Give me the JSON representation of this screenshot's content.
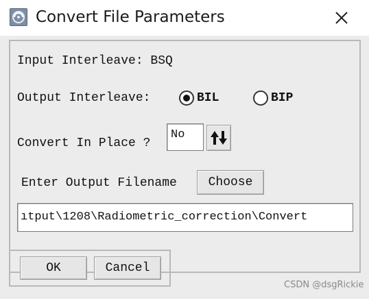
{
  "window": {
    "title": "Convert File Parameters"
  },
  "params": {
    "input_interleave_label": "Input Interleave: BSQ",
    "output_interleave_label": "Output Interleave:",
    "options": [
      {
        "label": "BIL",
        "selected": true
      },
      {
        "label": "BIP",
        "selected": false
      }
    ],
    "convert_in_place_label": "Convert In Place ?",
    "convert_in_place_value": "No",
    "output_filename_label": "Enter Output Filename",
    "choose_label": "Choose",
    "output_filename_value": "ıtput\\1208\\Radiometric_correction\\Convert"
  },
  "buttons": {
    "ok": "OK",
    "cancel": "Cancel"
  },
  "watermark": "CSDN @dsgRickie"
}
